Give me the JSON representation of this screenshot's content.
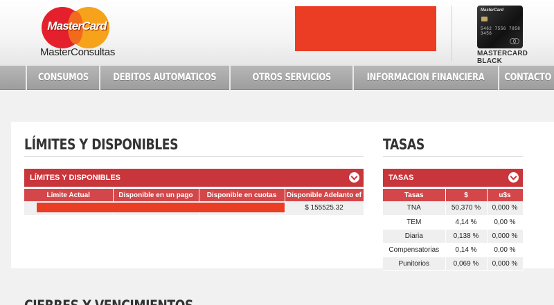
{
  "brand": {
    "logo_text": "MasterCard",
    "sub_title": "MasterConsultas"
  },
  "card": {
    "brand_text": "MasterCard",
    "number_text": "5462 7556 7858 3456",
    "label": "MASTERCARD BLACK"
  },
  "nav": {
    "items": [
      {
        "label": "CONSUMOS"
      },
      {
        "label": "DEBITOS AUTOMATICOS"
      },
      {
        "label": "OTROS SERVICIOS"
      },
      {
        "label": "INFORMACION FINANCIERA"
      },
      {
        "label": "CONTACTO"
      }
    ]
  },
  "limites": {
    "section_title": "LÍMITES Y DISPONIBLES",
    "bar_label": "LÍMITES Y DISPONIBLES",
    "headers": [
      "Límite Actual",
      "Disponible en un pago",
      "Disponible en cuotas",
      "Disponible Adelanto ef"
    ],
    "row": [
      "",
      "",
      "",
      "$ 155525.32"
    ]
  },
  "tasas": {
    "section_title": "TASAS",
    "bar_label": "TASAS",
    "headers": [
      "Tasas",
      "$",
      "u$s"
    ],
    "rows": [
      [
        "TNA",
        "50,370 %",
        "0,000 %"
      ],
      [
        "TEM",
        "4,14 %",
        "0,00 %"
      ],
      [
        "Diaria",
        "0,138 %",
        "0,000 %"
      ],
      [
        "Compensatorias",
        "0,14 %",
        "0,00 %"
      ],
      [
        "Punitorios",
        "0,069 %",
        "0,000 %"
      ]
    ]
  },
  "cierres": {
    "section_title": "CIERRES Y VENCIMIENTOS"
  },
  "colors": {
    "accent_red": "#c8353a",
    "header_red": "#d3474a",
    "redaction": "#eb3c24",
    "nav_gray": "#a8a8a8"
  }
}
